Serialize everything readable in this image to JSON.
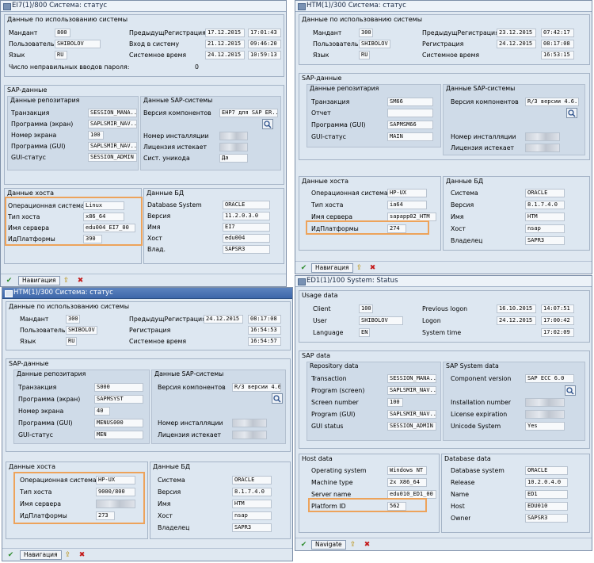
{
  "w1": {
    "title": "EI7(1)/800 Система: статус",
    "usage": {
      "title": "Данные по использованию системы",
      "rows": [
        {
          "l1": "Мандант",
          "v1": "800",
          "l2": "ПредыдущРегистрация",
          "d": "17.12.2015",
          "t": "17:01:43"
        },
        {
          "l1": "Пользователь",
          "v1": "SHIBOLOV",
          "l2": "Вход в систему",
          "d": "21.12.2015",
          "t": "09:46:20"
        },
        {
          "l1": "Язык",
          "v1": "RU",
          "l2": "Системное время",
          "d": "24.12.2015",
          "t": "10:59:13"
        }
      ],
      "pwd_label": "Число неправильных вводов пароля:",
      "pwd_value": "0"
    },
    "sap": {
      "title": "SAP-данные",
      "repo_title": "Данные репозитария",
      "repo": [
        {
          "l": "Транзакция",
          "v": "SESSION_MANA..."
        },
        {
          "l": "Программа (экран)",
          "v": "SAPLSMIR_NAV..."
        },
        {
          "l": "Номер экрана",
          "v": "100"
        },
        {
          "l": "Программа (GUI)",
          "v": "SAPLSMIR_NAV..."
        },
        {
          "l": "GUI-статус",
          "v": "SESSION_ADMIN"
        }
      ],
      "sys_title": "Данные SAP-системы",
      "sys": [
        {
          "l": "Версия компонентов",
          "v": "EHP7 для SAP ER..."
        },
        {
          "l": "Номер инсталляции",
          "v": ""
        },
        {
          "l": "Лицензия истекает",
          "v": ""
        },
        {
          "l": "Сист. уникода",
          "v": "Да"
        }
      ]
    },
    "host": {
      "title": "Данные хоста",
      "rows": [
        {
          "l": "Операционная система",
          "v": "Linux"
        },
        {
          "l": "Тип хоста",
          "v": "x86_64"
        },
        {
          "l": "Имя сервера",
          "v": "edu004_EI7_00"
        },
        {
          "l": "ИдПлатформы",
          "v": "390"
        }
      ]
    },
    "db": {
      "title": "Данные БД",
      "rows": [
        {
          "l": "Database System",
          "v": "ORACLE"
        },
        {
          "l": "Версия",
          "v": "11.2.0.3.0"
        },
        {
          "l": "Имя",
          "v": "EI7"
        },
        {
          "l": "Хост",
          "v": "edu004"
        },
        {
          "l": "Влад.",
          "v": "SAPSR3"
        }
      ]
    },
    "nav": "Навигация"
  },
  "w2": {
    "title": "HTM(1)/300 Система: статус",
    "usage": {
      "title": "Данные по использованию системы",
      "rows": [
        {
          "l1": "Мандант",
          "v1": "300",
          "l2": "ПредыдущРегистрация",
          "d": "23.12.2015",
          "t": "07:42:17"
        },
        {
          "l1": "Пользователь",
          "v1": "SHIBOLOV",
          "l2": "Регистрация",
          "d": "24.12.2015",
          "t": "08:17:08"
        },
        {
          "l1": "Язык",
          "v1": "RU",
          "l2": "Системное время",
          "d": "",
          "t": "16:53:15"
        }
      ]
    },
    "sap": {
      "title": "SAP-данные",
      "repo_title": "Данные репозитария",
      "repo": [
        {
          "l": "Транзакция",
          "v": "SM66"
        },
        {
          "l": "Отчет",
          "v": ""
        },
        {
          "l": "Программа (GUI)",
          "v": "SAPMSM66"
        },
        {
          "l": "GUI-статус",
          "v": "MAIN"
        }
      ],
      "sys_title": "Данные SAP-системы",
      "sys": [
        {
          "l": "Версия компонентов",
          "v": "R/3 версии 4.6..."
        },
        {
          "l": "Номер инсталляции",
          "v": ""
        },
        {
          "l": "Лицензия истекает",
          "v": ""
        }
      ]
    },
    "host": {
      "title": "Данные хоста",
      "rows": [
        {
          "l": "Операционная система",
          "v": "HP-UX"
        },
        {
          "l": "Тип хоста",
          "v": "ia64"
        },
        {
          "l": "Имя сервера",
          "v": "sapapp02_HTM"
        },
        {
          "l": "ИдПлатформы",
          "v": "274"
        }
      ]
    },
    "db": {
      "title": "Данные БД",
      "rows": [
        {
          "l": "Система",
          "v": "ORACLE"
        },
        {
          "l": "Версия",
          "v": "8.1.7.4.0"
        },
        {
          "l": "Имя",
          "v": "HTM"
        },
        {
          "l": "Хост",
          "v": "nsap"
        },
        {
          "l": "Владелец",
          "v": "SAPR3"
        }
      ]
    },
    "nav": "Навигация"
  },
  "w3": {
    "title": "HTM(1)/300 Система: статус",
    "usage": {
      "title": "Данные по использованию системы",
      "rows": [
        {
          "l1": "Мандант",
          "v1": "300",
          "l2": "ПредыдущРегистрация",
          "d": "24.12.2015",
          "t": "08:17:08"
        },
        {
          "l1": "Пользователь",
          "v1": "SHIBOLOV",
          "l2": "Регистрация",
          "d": "",
          "t": "16:54:53"
        },
        {
          "l1": "Язык",
          "v1": "RU",
          "l2": "Системное время",
          "d": "",
          "t": "16:54:57"
        }
      ]
    },
    "sap": {
      "title": "SAP-данные",
      "repo_title": "Данные репозитария",
      "repo": [
        {
          "l": "Транзакция",
          "v": "S000"
        },
        {
          "l": "Программа (экран)",
          "v": "SAPMSYST"
        },
        {
          "l": "Номер экрана",
          "v": "40"
        },
        {
          "l": "Программа (GUI)",
          "v": "MENUS000"
        },
        {
          "l": "GUI-статус",
          "v": "MEN"
        }
      ],
      "sys_title": "Данные SAP-системы",
      "sys": [
        {
          "l": "Версия компонентов",
          "v": "R/3 версии 4.6..."
        },
        {
          "l": "Номер инсталляции",
          "v": ""
        },
        {
          "l": "Лицензия истекает",
          "v": ""
        }
      ]
    },
    "host": {
      "title": "Данные хоста",
      "rows": [
        {
          "l": "Операционная система",
          "v": "HP-UX"
        },
        {
          "l": "Тип хоста",
          "v": "9000/800"
        },
        {
          "l": "Имя сервера",
          "v": ""
        },
        {
          "l": "ИдПлатформы",
          "v": "273"
        }
      ]
    },
    "db": {
      "title": "Данные БД",
      "rows": [
        {
          "l": "Система",
          "v": "ORACLE"
        },
        {
          "l": "Версия",
          "v": "8.1.7.4.0"
        },
        {
          "l": "Имя",
          "v": "HTM"
        },
        {
          "l": "Хост",
          "v": "nsap"
        },
        {
          "l": "Владелец",
          "v": "SAPR3"
        }
      ]
    },
    "nav": "Навигация"
  },
  "w4": {
    "title": "ED1(1)/100 System: Status",
    "usage": {
      "title": "Usage data",
      "rows": [
        {
          "l1": "Client",
          "v1": "100",
          "l2": "Previous logon",
          "d": "16.10.2015",
          "t": "14:07:51"
        },
        {
          "l1": "User",
          "v1": "SHIBOLOV",
          "l2": "Logon",
          "d": "24.12.2015",
          "t": "17:00:42"
        },
        {
          "l1": "Language",
          "v1": "EN",
          "l2": "System time",
          "d": "",
          "t": "17:02:09"
        }
      ]
    },
    "sap": {
      "title": "SAP data",
      "repo_title": "Repository data",
      "repo": [
        {
          "l": "Transaction",
          "v": "SESSION_MANA..."
        },
        {
          "l": "Program (screen)",
          "v": "SAPLSMIR_NAV..."
        },
        {
          "l": "Screen number",
          "v": "100"
        },
        {
          "l": "Program (GUI)",
          "v": "SAPLSMIR_NAV..."
        },
        {
          "l": "GUI status",
          "v": "SESSION_ADMIN"
        }
      ],
      "sys_title": "SAP System data",
      "sys": [
        {
          "l": "Component version",
          "v": "SAP ECC 6.0"
        },
        {
          "l": "Installation number",
          "v": ""
        },
        {
          "l": "License expiration",
          "v": ""
        },
        {
          "l": "Unicode System",
          "v": "Yes"
        }
      ]
    },
    "host": {
      "title": "Host data",
      "rows": [
        {
          "l": "Operating system",
          "v": "Windows NT"
        },
        {
          "l": "Machine type",
          "v": "2x X86_64"
        },
        {
          "l": "Server name",
          "v": "edu010_ED1_00"
        },
        {
          "l": "Platform ID",
          "v": "562"
        }
      ]
    },
    "db": {
      "title": "Database data",
      "rows": [
        {
          "l": "Database system",
          "v": "ORACLE"
        },
        {
          "l": "Release",
          "v": "10.2.0.4.0"
        },
        {
          "l": "Name",
          "v": "ED1"
        },
        {
          "l": "Host",
          "v": "EDU010"
        },
        {
          "l": "Owner",
          "v": "SAPSR3"
        }
      ]
    },
    "nav": "Navigate"
  },
  "colors": {
    "highlight": "#eda35b",
    "frame": "#dfe8f1",
    "group": "#cfdbe8"
  },
  "icons": [
    "check-icon",
    "find-icon",
    "cancel-icon",
    "display-icon"
  ]
}
